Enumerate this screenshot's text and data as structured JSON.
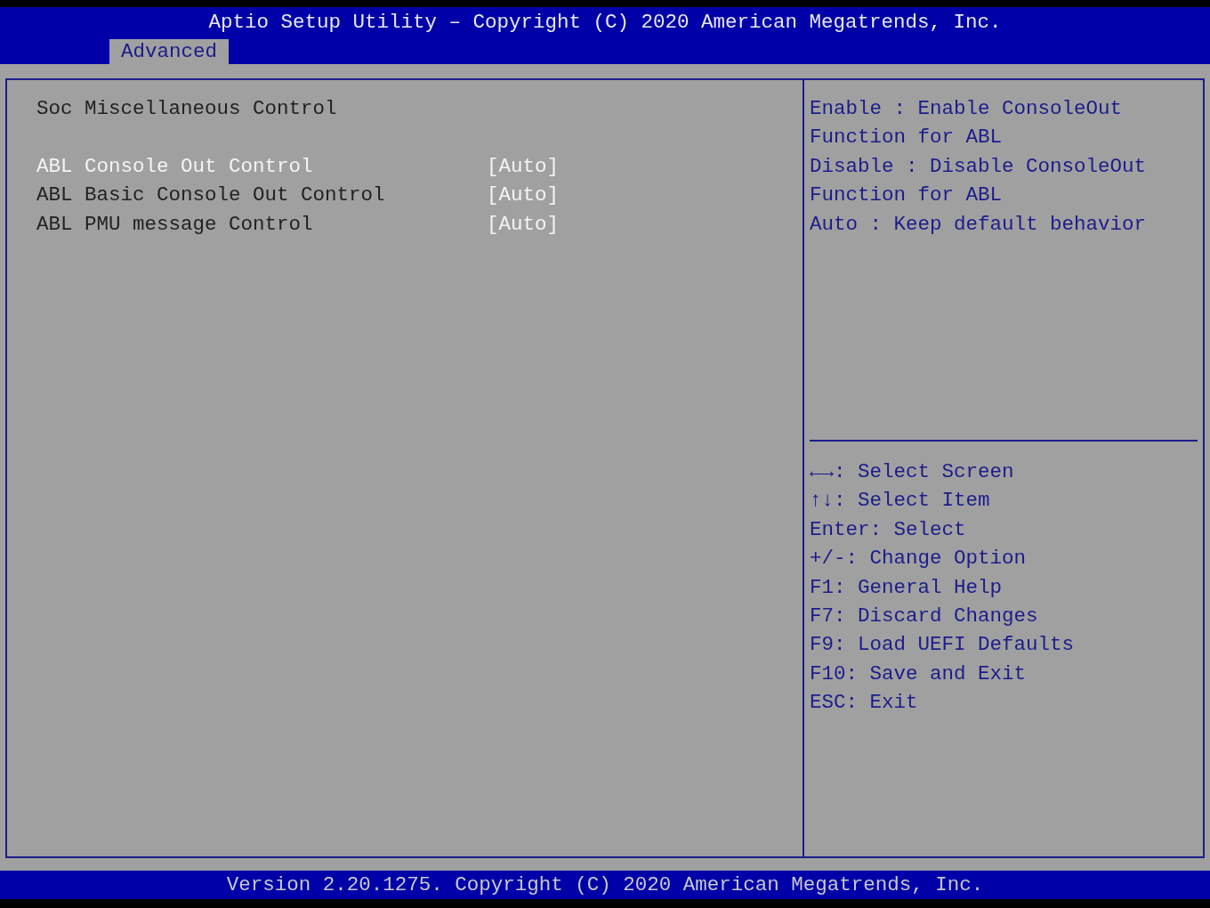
{
  "header": {
    "title": "Aptio Setup Utility – Copyright (C) 2020 American Megatrends, Inc."
  },
  "tabs": [
    {
      "label": "Advanced",
      "selected": true
    }
  ],
  "main": {
    "heading": "Soc Miscellaneous Control",
    "items": [
      {
        "label": "ABL Console Out Control",
        "value": "[Auto]",
        "selected": true
      },
      {
        "label": "ABL Basic Console Out Control",
        "value": "[Auto]",
        "selected": false
      },
      {
        "label": "ABL PMU message Control",
        "value": "[Auto]",
        "selected": false
      }
    ]
  },
  "help": {
    "lines": [
      "Enable : Enable ConsoleOut",
      "Function for ABL",
      "Disable : Disable ConsoleOut",
      "Function for ABL",
      "Auto : Keep default behavior"
    ]
  },
  "keys": [
    "←→: Select Screen",
    "↑↓: Select Item",
    "Enter: Select",
    "+/-: Change Option",
    "F1: General Help",
    "F7: Discard Changes",
    "F9: Load UEFI Defaults",
    "F10: Save and Exit",
    "ESC: Exit"
  ],
  "footer": {
    "text": "Version 2.20.1275. Copyright (C) 2020 American Megatrends, Inc."
  }
}
